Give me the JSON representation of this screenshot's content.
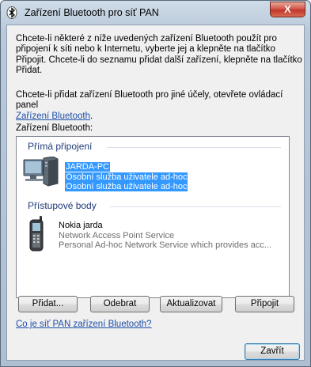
{
  "window": {
    "title": "Zařízení Bluetooth pro síť PAN",
    "close_label": "X"
  },
  "intro": {
    "line1": "Chcete-li některé z níže uvedených zařízení Bluetooth použít pro",
    "line2": "připojení k síti nebo k Internetu, vyberte jej a klepněte na tlačítko",
    "line3": "Připojit. Chcete-li do seznamu přidat další zařízení, klepněte na tlačítko",
    "line4": "Přidat."
  },
  "other": {
    "line1": "Chcete-li přidat zařízení Bluetooth pro jiné účely, otevřete ovládací panel",
    "link": "Zařízení Bluetooth",
    "link_suffix": "."
  },
  "devices_label": "Zařízení Bluetooth:",
  "groups": {
    "direct": {
      "label": "Přímá připojení",
      "device": {
        "name": "JARDA-PC",
        "line2": "Osobní služba uživatele ad-hoc",
        "line3": "Osobní služba uživatele ad-hoc"
      }
    },
    "access": {
      "label": "Přístupové body",
      "device": {
        "name": "Nokia jarda",
        "line2": "Network Access Point Service",
        "line3": "Personal Ad-hoc Network Service which provides acc..."
      }
    }
  },
  "buttons": {
    "add": "Přidat...",
    "remove": "Odebrat",
    "refresh": "Aktualizovat",
    "connect": "Připojit",
    "close": "Zavřít"
  },
  "help_link": "Co je síť PAN zařízení Bluetooth?",
  "colors": {
    "selection": "#3399ff",
    "link": "#1f4fa8",
    "group": "#1e3a78"
  }
}
